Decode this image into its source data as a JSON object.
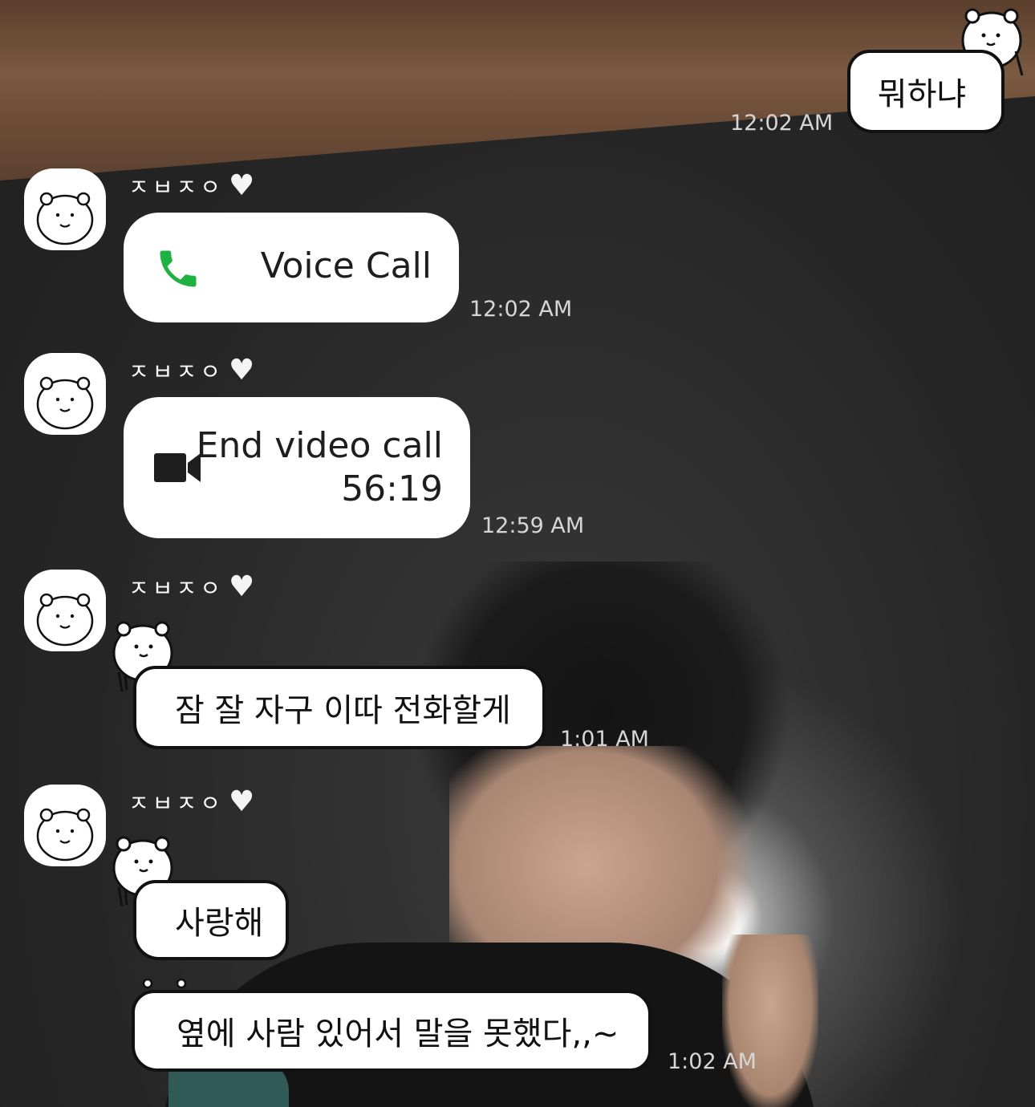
{
  "messages": [
    {
      "type": "sent_emoticon",
      "text": "뭐하냐",
      "time": "12:02 AM"
    },
    {
      "type": "received_call",
      "sender": "ㅈㅂㅈㅇ",
      "label": "Voice Call",
      "time": "12:02 AM"
    },
    {
      "type": "received_call",
      "sender": "ㅈㅂㅈㅇ",
      "label": "End video call",
      "duration": "56:19",
      "time": "12:59 AM"
    },
    {
      "type": "received_emoticon",
      "sender": "ㅈㅂㅈㅇ",
      "text": "잠 잘 자구 이따 전화할게",
      "time": "1:01 AM"
    },
    {
      "type": "received_emoticon",
      "sender": "ㅈㅂㅈㅇ",
      "text": "사랑해"
    },
    {
      "type": "received_emoticon",
      "text": "옆에 사람 있어서 말을 못했다,,~",
      "time": "1:02 AM"
    }
  ],
  "icons": {
    "voice": "phone-icon",
    "video": "video-camera-icon",
    "heart": "white-heart-icon",
    "avatar": "bear-avatar-icon",
    "emoticon": "bear-emoticon-icon"
  },
  "colors": {
    "call_green": "#1fb141",
    "bubble": "#ffffff",
    "time_text": "#d6d6d6"
  }
}
